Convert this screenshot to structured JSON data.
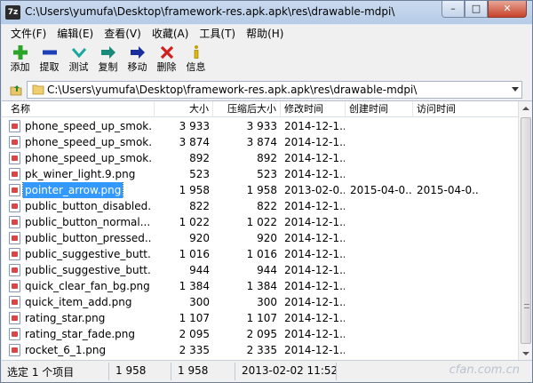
{
  "window": {
    "title": "C:\\Users\\yumufa\\Desktop\\framework-res.apk.apk\\res\\drawable-mdpi\\",
    "app_icon": "7z",
    "minimize": "–",
    "maximize": "□",
    "close": "✕"
  },
  "menu": [
    "文件(F)",
    "编辑(E)",
    "查看(V)",
    "收藏(A)",
    "工具(T)",
    "帮助(H)"
  ],
  "toolbar": [
    {
      "label": "添加",
      "icon": "plus-icon"
    },
    {
      "label": "提取",
      "icon": "minus-icon"
    },
    {
      "label": "测试",
      "icon": "check-icon"
    },
    {
      "label": "复制",
      "icon": "copy-arrow-icon"
    },
    {
      "label": "移动",
      "icon": "move-arrow-icon"
    },
    {
      "label": "删除",
      "icon": "delete-x-icon"
    },
    {
      "label": "信息",
      "icon": "info-icon"
    }
  ],
  "address": {
    "path": "C:\\Users\\yumufa\\Desktop\\framework-res.apk.apk\\res\\drawable-mdpi\\"
  },
  "columns": [
    "名称",
    "大小",
    "压缩后大小",
    "修改时间",
    "创建时间",
    "访问时间"
  ],
  "rows": [
    {
      "name": "phone_speed_up_smok...",
      "size": "3 933",
      "packed": "3 933",
      "modified": "2014-12-1...",
      "created": "",
      "accessed": ""
    },
    {
      "name": "phone_speed_up_smok...",
      "size": "3 874",
      "packed": "3 874",
      "modified": "2014-12-1...",
      "created": "",
      "accessed": ""
    },
    {
      "name": "phone_speed_up_smok...",
      "size": "892",
      "packed": "892",
      "modified": "2014-12-1...",
      "created": "",
      "accessed": ""
    },
    {
      "name": "pk_winer_light.9.png",
      "size": "523",
      "packed": "523",
      "modified": "2014-12-1...",
      "created": "",
      "accessed": ""
    },
    {
      "name": "pointer_arrow.png",
      "size": "1 958",
      "packed": "1 958",
      "modified": "2013-02-0...",
      "created": "2015-04-0...",
      "accessed": "2015-04-0...",
      "selected": true
    },
    {
      "name": "public_button_disabled...",
      "size": "822",
      "packed": "822",
      "modified": "2014-12-1...",
      "created": "",
      "accessed": ""
    },
    {
      "name": "public_button_normal....",
      "size": "1 022",
      "packed": "1 022",
      "modified": "2014-12-1...",
      "created": "",
      "accessed": ""
    },
    {
      "name": "public_button_pressed....",
      "size": "920",
      "packed": "920",
      "modified": "2014-12-1...",
      "created": "",
      "accessed": ""
    },
    {
      "name": "public_suggestive_butt...",
      "size": "1 016",
      "packed": "1 016",
      "modified": "2014-12-1...",
      "created": "",
      "accessed": ""
    },
    {
      "name": "public_suggestive_butt...",
      "size": "944",
      "packed": "944",
      "modified": "2014-12-1...",
      "created": "",
      "accessed": ""
    },
    {
      "name": "quick_clear_fan_bg.png",
      "size": "1 384",
      "packed": "1 384",
      "modified": "2014-12-1...",
      "created": "",
      "accessed": ""
    },
    {
      "name": "quick_item_add.png",
      "size": "300",
      "packed": "300",
      "modified": "2014-12-1...",
      "created": "",
      "accessed": ""
    },
    {
      "name": "rating_star.png",
      "size": "1 107",
      "packed": "1 107",
      "modified": "2014-12-1...",
      "created": "",
      "accessed": ""
    },
    {
      "name": "rating_star_fade.png",
      "size": "2 095",
      "packed": "2 095",
      "modified": "2014-12-1...",
      "created": "",
      "accessed": ""
    },
    {
      "name": "rocket_6_1.png",
      "size": "2 335",
      "packed": "2 335",
      "modified": "2014-12-1...",
      "created": "",
      "accessed": ""
    }
  ],
  "status": {
    "selection": "选定 1 个项目",
    "size": "1 958",
    "packed": "1 958",
    "modified": "2013-02-02 11:52",
    "watermark": "cfan.com.cn"
  }
}
